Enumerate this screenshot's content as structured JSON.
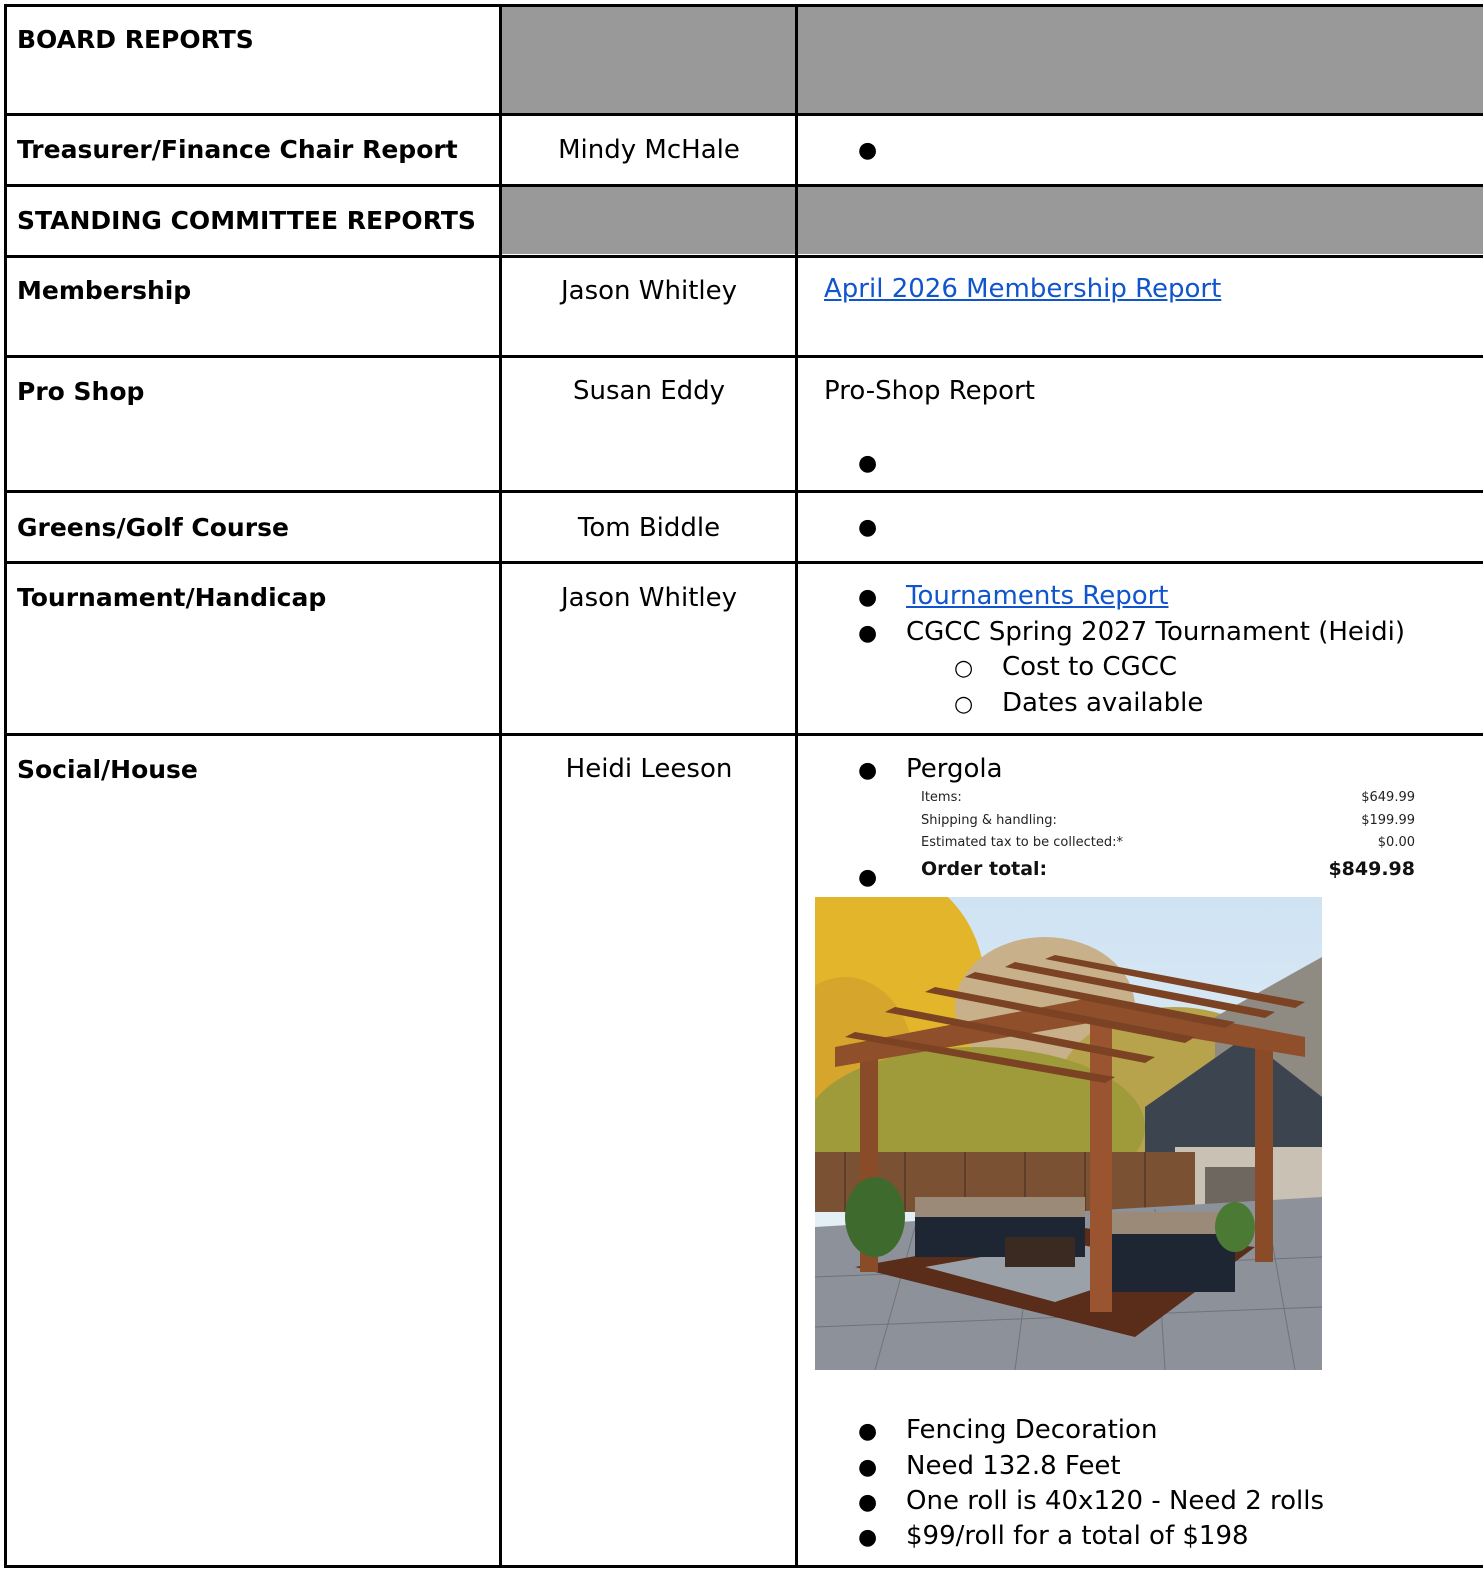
{
  "rows": {
    "board_reports": {
      "label": "BOARD REPORTS"
    },
    "treasurer": {
      "label": "Treasurer/Finance Chair Report",
      "person": "Mindy McHale"
    },
    "standing": {
      "label": "STANDING COMMITTEE REPORTS"
    },
    "membership": {
      "label": "Membership",
      "person": "Jason Whitley",
      "link": "April 2026 Membership Report"
    },
    "proshop": {
      "label": "Pro Shop",
      "person": "Susan Eddy",
      "text": "Pro-Shop Report"
    },
    "greens": {
      "label": "Greens/Golf Course",
      "person": "Tom Biddle"
    },
    "tournament": {
      "label": "Tournament/Handicap",
      "person": "Jason Whitley",
      "link": "Tournaments Report",
      "item2": "CGCC Spring 2027 Tournament (Heidi)",
      "sub1": "Cost to CGCC",
      "sub2": "Dates available"
    },
    "social": {
      "label": "Social/House",
      "person": "Heidi Leeson",
      "item1": "Pergola",
      "order": {
        "items_label": "Items:",
        "items_value": "$649.99",
        "shipping_label": "Shipping & handling:",
        "shipping_value": "$199.99",
        "tax_label": "Estimated tax to be collected:*",
        "tax_value": "$0.00",
        "total_label": "Order total:",
        "total_value": "$849.98"
      },
      "items_after": [
        "Fencing Decoration",
        "Need 132.8 Feet",
        "One roll is 40x120 - Need 2 rolls",
        "$99/roll for a total of $198"
      ]
    }
  },
  "glyphs": {
    "bullet": "●",
    "circle": "○"
  },
  "colors": {
    "header_gray": "#999999",
    "link": "#1155cc",
    "border": "#000000"
  }
}
